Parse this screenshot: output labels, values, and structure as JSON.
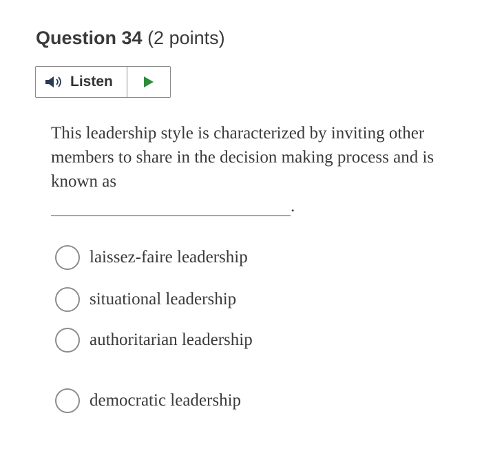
{
  "question": {
    "number_label": "Question 34",
    "points_label": "(2 points)"
  },
  "listen": {
    "label": "Listen",
    "speaker_icon": "speaker-icon",
    "play_icon": "play-icon",
    "play_color": "#2e8b3a"
  },
  "prompt": {
    "text": "This leadership style is characterized by inviting other members to share in the decision making process and is known as",
    "blank_suffix": "."
  },
  "options": [
    {
      "label": "laissez-faire leadership",
      "selected": false
    },
    {
      "label": "situational leadership",
      "selected": false
    },
    {
      "label": "authoritarian leadership",
      "selected": false
    },
    {
      "label": "democratic leadership",
      "selected": false
    }
  ]
}
